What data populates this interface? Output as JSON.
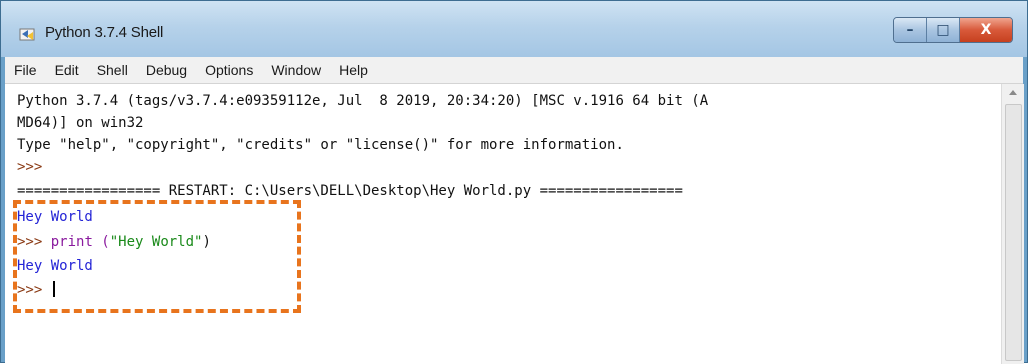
{
  "window": {
    "title": "Python 3.7.4 Shell",
    "controls": {
      "minimize": "–",
      "maximize": "□",
      "close": "X"
    }
  },
  "menu": [
    "File",
    "Edit",
    "Shell",
    "Debug",
    "Options",
    "Window",
    "Help"
  ],
  "shell": {
    "banner_line1": "Python 3.7.4 (tags/v3.7.4:e09359112e, Jul  8 2019, 20:34:20) [MSC v.1916 64 bit (A",
    "banner_line2": "MD64)] on win32",
    "banner_line3": "Type \"help\", \"copyright\", \"credits\" or \"license()\" for more information.",
    "prompt": ">>>",
    "restart_line": "================= RESTART: C:\\Users\\DELL\\Desktop\\Hey World.py =================",
    "output1": "Hey World",
    "command_prefix": "print (",
    "command_string": "\"Hey World\"",
    "command_suffix": ")",
    "output2": "Hey World"
  },
  "colors": {
    "highlight_border": "#e8741d",
    "output_text": "#2424d6",
    "string_literal": "#1a8a1a",
    "prompt_text": "#8a3a14"
  }
}
